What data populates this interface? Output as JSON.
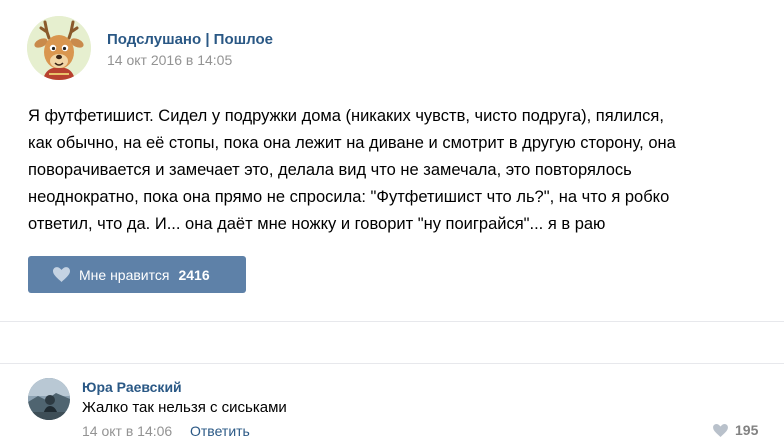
{
  "post": {
    "author": "Подслушано | Пошлое",
    "date": "14 окт 2016 в 14:05",
    "avatar_icon": "deer-cartoon-avatar",
    "text_lines": [
      "Я футфетишист. Сидел у подружки дома (никаких чувств, чисто подруга), пялился,",
      "как обычно, на её стопы, пока она лежит на диване и смотрит в другую сторону, она",
      "поворачивается и замечает это, делала вид что не замечала, это повторялось",
      "неоднократно, пока она прямо не спросила: \"Футфетишист что ль?\", на что я робко",
      "ответил, что да. И... она даёт мне ножку и говорит \"ну поиграйся\"... я в раю"
    ],
    "like_button": {
      "label": "Мне нравится",
      "count": "2416",
      "icon": "heart-icon",
      "color": "#5e81a8"
    }
  },
  "comment": {
    "author": "Юра Раевский",
    "text": "Жалко так нельзя с сиськами",
    "date": "14 окт в 14:06",
    "reply_label": "Ответить",
    "like_count": "195",
    "like_icon": "heart-icon",
    "avatar_icon": "user-photo-avatar"
  },
  "colors": {
    "link": "#2a5885",
    "meta": "#939393",
    "divider": "#e7e8ec"
  }
}
